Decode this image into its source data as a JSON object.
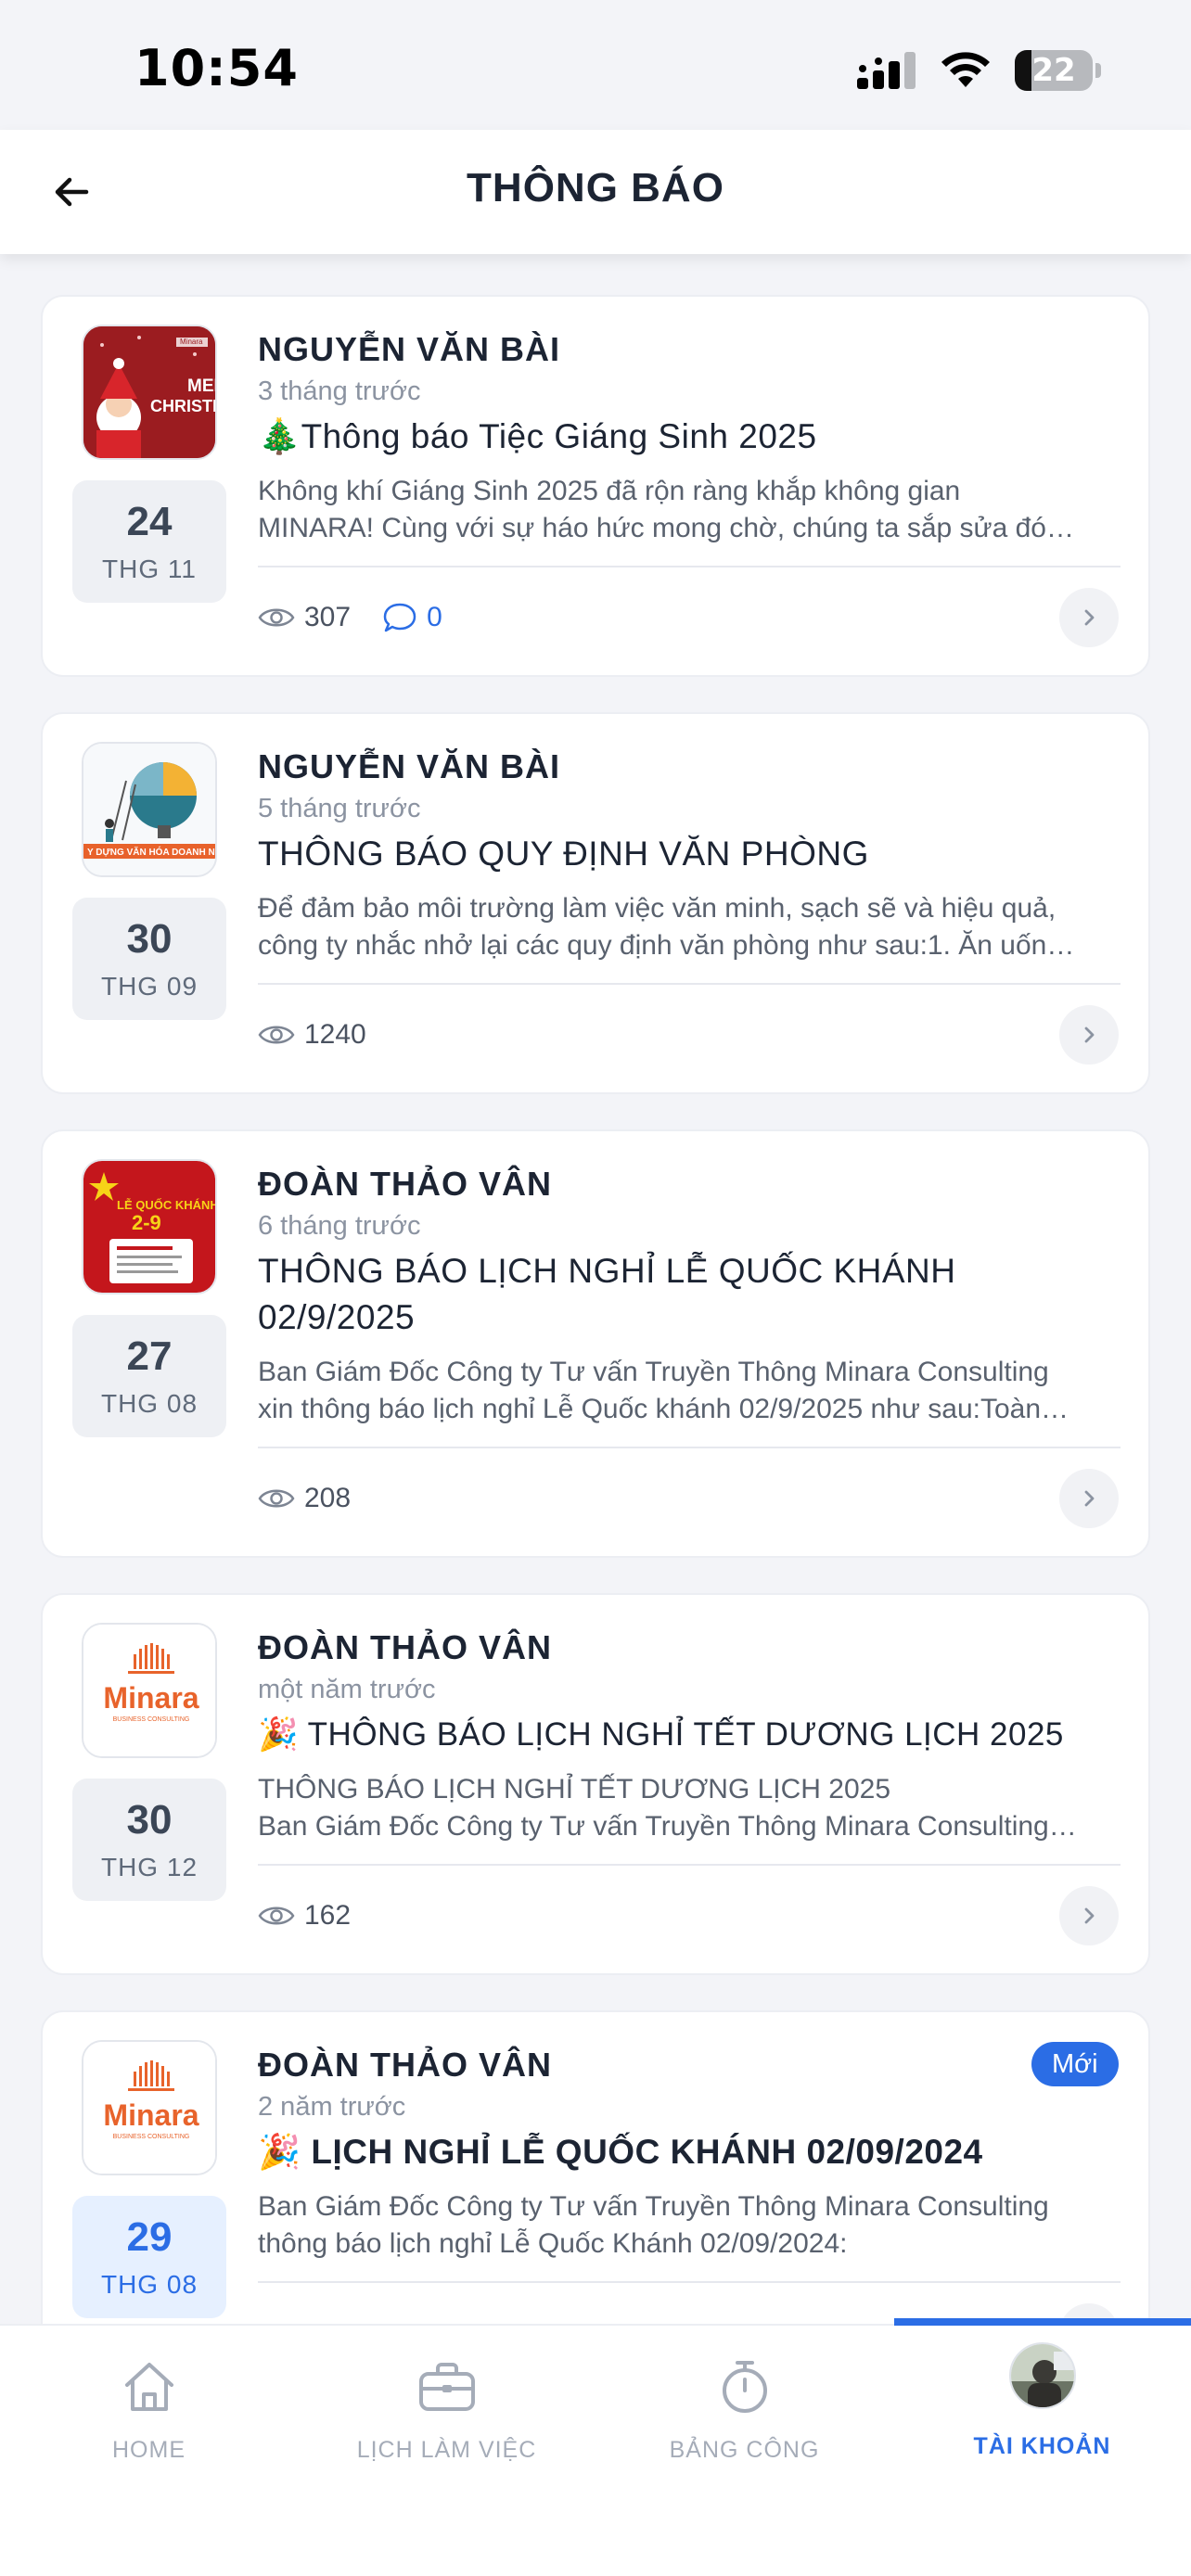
{
  "status_bar": {
    "time": "10:54",
    "battery": "22",
    "battery_level": 0.22
  },
  "header": {
    "title": "THÔNG BÁO"
  },
  "notifications": [
    {
      "author": "NGUYỄN VĂN BÀI",
      "time_ago": "3 tháng trước",
      "title": "🎄Thông báo Tiệc Giáng Sinh 2025",
      "excerpt_lines": [
        "Không khí Giáng Sinh 2025 đã rộn ràng khắp không gian",
        "MINARA! Cùng với sự háo hức mong chờ, chúng ta sắp sửa đó…"
      ],
      "date_day": "24",
      "date_month": "THG 11",
      "views": "307",
      "comments": "0",
      "thumb_texts": [
        "MERRY",
        "CHRISTM",
        "Minara"
      ]
    },
    {
      "author": "NGUYỄN VĂN BÀI",
      "time_ago": "5 tháng trước",
      "title": "THÔNG BÁO QUY ĐỊNH VĂN PHÒNG",
      "excerpt_lines": [
        "Để đảm bảo môi trường làm việc văn minh, sạch sẽ và hiệu quả,",
        "công ty nhắc nhở lại các quy định văn phòng như sau:1. Ăn uốn…"
      ],
      "date_day": "30",
      "date_month": "THG 09",
      "views": "1240",
      "thumb_texts": [
        "Y DỰNG VĂN HÓA DOANH NGH"
      ]
    },
    {
      "author": "ĐOÀN THẢO VÂN",
      "time_ago": "6 tháng trước",
      "title_lines": [
        "THÔNG BÁO LỊCH NGHỈ LỄ QUỐC KHÁNH",
        "02/9/2025"
      ],
      "excerpt_lines": [
        "Ban Giám Đốc Công ty Tư vấn Truyền Thông Minara Consulting",
        "xin thông báo lịch nghỉ Lễ Quốc khánh 02/9/2025 như sau:Toàn…"
      ],
      "date_day": "27",
      "date_month": "THG 08",
      "views": "208",
      "thumb_texts": [
        "LỄ QUỐC KHÁNH",
        "2-9"
      ]
    },
    {
      "author": "ĐOÀN THẢO VÂN",
      "time_ago": "một năm trước",
      "title": "🎉 THÔNG BÁO LỊCH NGHỈ TẾT DƯƠNG LỊCH 2025",
      "excerpt_lines": [
        "THÔNG BÁO LỊCH NGHỈ TẾT DƯƠNG LỊCH 2025",
        "Ban Giám Đốc Công ty Tư vấn Truyền Thông Minara Consulting…"
      ],
      "date_day": "30",
      "date_month": "THG 12",
      "views": "162",
      "thumb_texts": [
        "Minara",
        "BUSINESS CONSULTING"
      ]
    },
    {
      "author": "ĐOÀN THẢO VÂN",
      "time_ago": "2 năm trước",
      "title": "🎉 LỊCH NGHỈ LỄ QUỐC KHÁNH 02/09/2024",
      "excerpt_lines": [
        "Ban Giám Đốc Công ty Tư vấn Truyền Thông Minara Consulting",
        "thông báo lịch nghỉ Lễ Quốc Khánh 02/09/2024:"
      ],
      "date_day": "29",
      "date_month": "THG 08",
      "badge": "Mới",
      "thumb_texts": [
        "Minara",
        "BUSINESS CONSULTING"
      ]
    }
  ],
  "bottom_nav": [
    {
      "label": "HOME",
      "icon": "home-icon",
      "active": false
    },
    {
      "label": "LỊCH LÀM VIỆC",
      "icon": "briefcase-icon",
      "active": false
    },
    {
      "label": "BẢNG CÔNG",
      "icon": "stopwatch-icon",
      "active": false
    },
    {
      "label": "TÀI KHOẢN",
      "icon": "avatar",
      "active": true
    }
  ],
  "colors": {
    "accent": "#2b6de5",
    "background": "#f3f4f8",
    "card": "#ffffff",
    "text": "#1c2433",
    "muted": "#8b93a1"
  }
}
